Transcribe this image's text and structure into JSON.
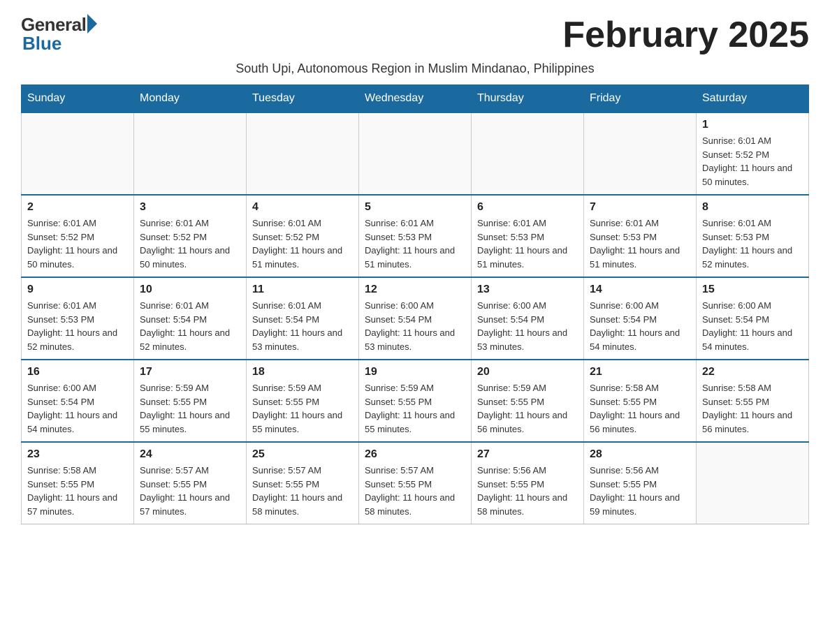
{
  "header": {
    "logo_general": "General",
    "logo_blue": "Blue",
    "month_title": "February 2025",
    "subtitle": "South Upi, Autonomous Region in Muslim Mindanao, Philippines"
  },
  "weekdays": [
    "Sunday",
    "Monday",
    "Tuesday",
    "Wednesday",
    "Thursday",
    "Friday",
    "Saturday"
  ],
  "weeks": [
    [
      {
        "day": "",
        "info": ""
      },
      {
        "day": "",
        "info": ""
      },
      {
        "day": "",
        "info": ""
      },
      {
        "day": "",
        "info": ""
      },
      {
        "day": "",
        "info": ""
      },
      {
        "day": "",
        "info": ""
      },
      {
        "day": "1",
        "info": "Sunrise: 6:01 AM\nSunset: 5:52 PM\nDaylight: 11 hours and 50 minutes."
      }
    ],
    [
      {
        "day": "2",
        "info": "Sunrise: 6:01 AM\nSunset: 5:52 PM\nDaylight: 11 hours and 50 minutes."
      },
      {
        "day": "3",
        "info": "Sunrise: 6:01 AM\nSunset: 5:52 PM\nDaylight: 11 hours and 50 minutes."
      },
      {
        "day": "4",
        "info": "Sunrise: 6:01 AM\nSunset: 5:52 PM\nDaylight: 11 hours and 51 minutes."
      },
      {
        "day": "5",
        "info": "Sunrise: 6:01 AM\nSunset: 5:53 PM\nDaylight: 11 hours and 51 minutes."
      },
      {
        "day": "6",
        "info": "Sunrise: 6:01 AM\nSunset: 5:53 PM\nDaylight: 11 hours and 51 minutes."
      },
      {
        "day": "7",
        "info": "Sunrise: 6:01 AM\nSunset: 5:53 PM\nDaylight: 11 hours and 51 minutes."
      },
      {
        "day": "8",
        "info": "Sunrise: 6:01 AM\nSunset: 5:53 PM\nDaylight: 11 hours and 52 minutes."
      }
    ],
    [
      {
        "day": "9",
        "info": "Sunrise: 6:01 AM\nSunset: 5:53 PM\nDaylight: 11 hours and 52 minutes."
      },
      {
        "day": "10",
        "info": "Sunrise: 6:01 AM\nSunset: 5:54 PM\nDaylight: 11 hours and 52 minutes."
      },
      {
        "day": "11",
        "info": "Sunrise: 6:01 AM\nSunset: 5:54 PM\nDaylight: 11 hours and 53 minutes."
      },
      {
        "day": "12",
        "info": "Sunrise: 6:00 AM\nSunset: 5:54 PM\nDaylight: 11 hours and 53 minutes."
      },
      {
        "day": "13",
        "info": "Sunrise: 6:00 AM\nSunset: 5:54 PM\nDaylight: 11 hours and 53 minutes."
      },
      {
        "day": "14",
        "info": "Sunrise: 6:00 AM\nSunset: 5:54 PM\nDaylight: 11 hours and 54 minutes."
      },
      {
        "day": "15",
        "info": "Sunrise: 6:00 AM\nSunset: 5:54 PM\nDaylight: 11 hours and 54 minutes."
      }
    ],
    [
      {
        "day": "16",
        "info": "Sunrise: 6:00 AM\nSunset: 5:54 PM\nDaylight: 11 hours and 54 minutes."
      },
      {
        "day": "17",
        "info": "Sunrise: 5:59 AM\nSunset: 5:55 PM\nDaylight: 11 hours and 55 minutes."
      },
      {
        "day": "18",
        "info": "Sunrise: 5:59 AM\nSunset: 5:55 PM\nDaylight: 11 hours and 55 minutes."
      },
      {
        "day": "19",
        "info": "Sunrise: 5:59 AM\nSunset: 5:55 PM\nDaylight: 11 hours and 55 minutes."
      },
      {
        "day": "20",
        "info": "Sunrise: 5:59 AM\nSunset: 5:55 PM\nDaylight: 11 hours and 56 minutes."
      },
      {
        "day": "21",
        "info": "Sunrise: 5:58 AM\nSunset: 5:55 PM\nDaylight: 11 hours and 56 minutes."
      },
      {
        "day": "22",
        "info": "Sunrise: 5:58 AM\nSunset: 5:55 PM\nDaylight: 11 hours and 56 minutes."
      }
    ],
    [
      {
        "day": "23",
        "info": "Sunrise: 5:58 AM\nSunset: 5:55 PM\nDaylight: 11 hours and 57 minutes."
      },
      {
        "day": "24",
        "info": "Sunrise: 5:57 AM\nSunset: 5:55 PM\nDaylight: 11 hours and 57 minutes."
      },
      {
        "day": "25",
        "info": "Sunrise: 5:57 AM\nSunset: 5:55 PM\nDaylight: 11 hours and 58 minutes."
      },
      {
        "day": "26",
        "info": "Sunrise: 5:57 AM\nSunset: 5:55 PM\nDaylight: 11 hours and 58 minutes."
      },
      {
        "day": "27",
        "info": "Sunrise: 5:56 AM\nSunset: 5:55 PM\nDaylight: 11 hours and 58 minutes."
      },
      {
        "day": "28",
        "info": "Sunrise: 5:56 AM\nSunset: 5:55 PM\nDaylight: 11 hours and 59 minutes."
      },
      {
        "day": "",
        "info": ""
      }
    ]
  ]
}
